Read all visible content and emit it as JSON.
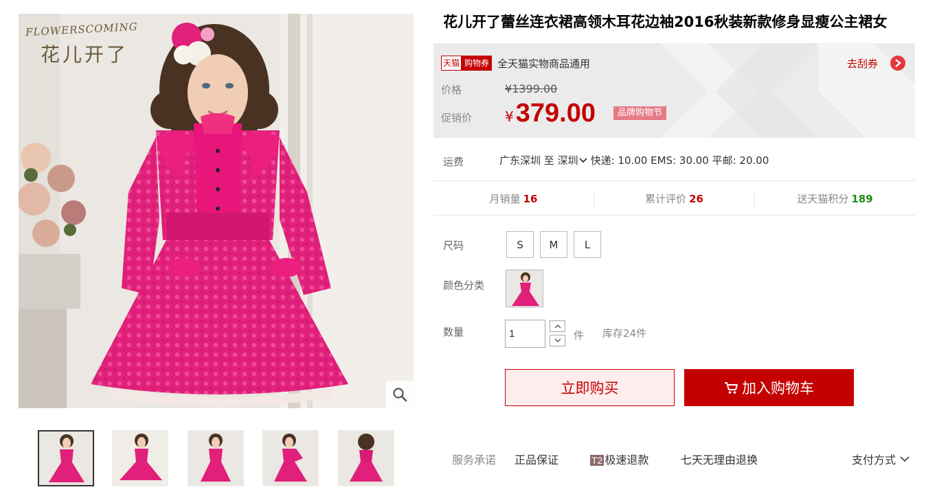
{
  "product": {
    "title": "花儿开了蕾丝连衣裙高领木耳花边袖2016秋装新款修身显瘦公主裙女",
    "brand_en": "FLOWERSCOMING",
    "brand_cn": "花儿开了"
  },
  "promo": {
    "tag_tmall": "天猫",
    "tag_coupon": "购物券",
    "coupon_text": "全天猫实物商品通用",
    "get_coupon": "去刮券"
  },
  "price": {
    "label": "价格",
    "currency": "¥",
    "original": "1399.00",
    "sale_label": "促销价",
    "sale": "379.00",
    "festival_badge": "品牌购物节"
  },
  "shipping": {
    "label": "运费",
    "from": "广东深圳",
    "to_word": "至",
    "to": "深圳",
    "rates": "快递: 10.00 EMS: 30.00 平邮: 20.00"
  },
  "stats": {
    "monthly_sales_label": "月销量",
    "monthly_sales": "16",
    "reviews_label": "累计评价",
    "reviews": "26",
    "points_label": "送天猫积分",
    "points": "189"
  },
  "options": {
    "size_label": "尺码",
    "sizes": [
      "S",
      "M",
      "L"
    ],
    "color_label": "颜色分类",
    "quantity_label": "数量",
    "quantity": "1",
    "unit": "件",
    "stock": "库存24件"
  },
  "actions": {
    "buy_now": "立即购买",
    "add_to_cart": "加入购物车"
  },
  "services": {
    "label": "服务承诺",
    "genuine": "正品保证",
    "t2_badge": "T2",
    "fast_refund": "极速退款",
    "seven_day": "七天无理由退换",
    "payment": "支付方式"
  },
  "colors": {
    "accent": "#c40000",
    "dress": "#e0207a",
    "points_green": "#1a8f0f"
  },
  "thumbnails_count": 5
}
